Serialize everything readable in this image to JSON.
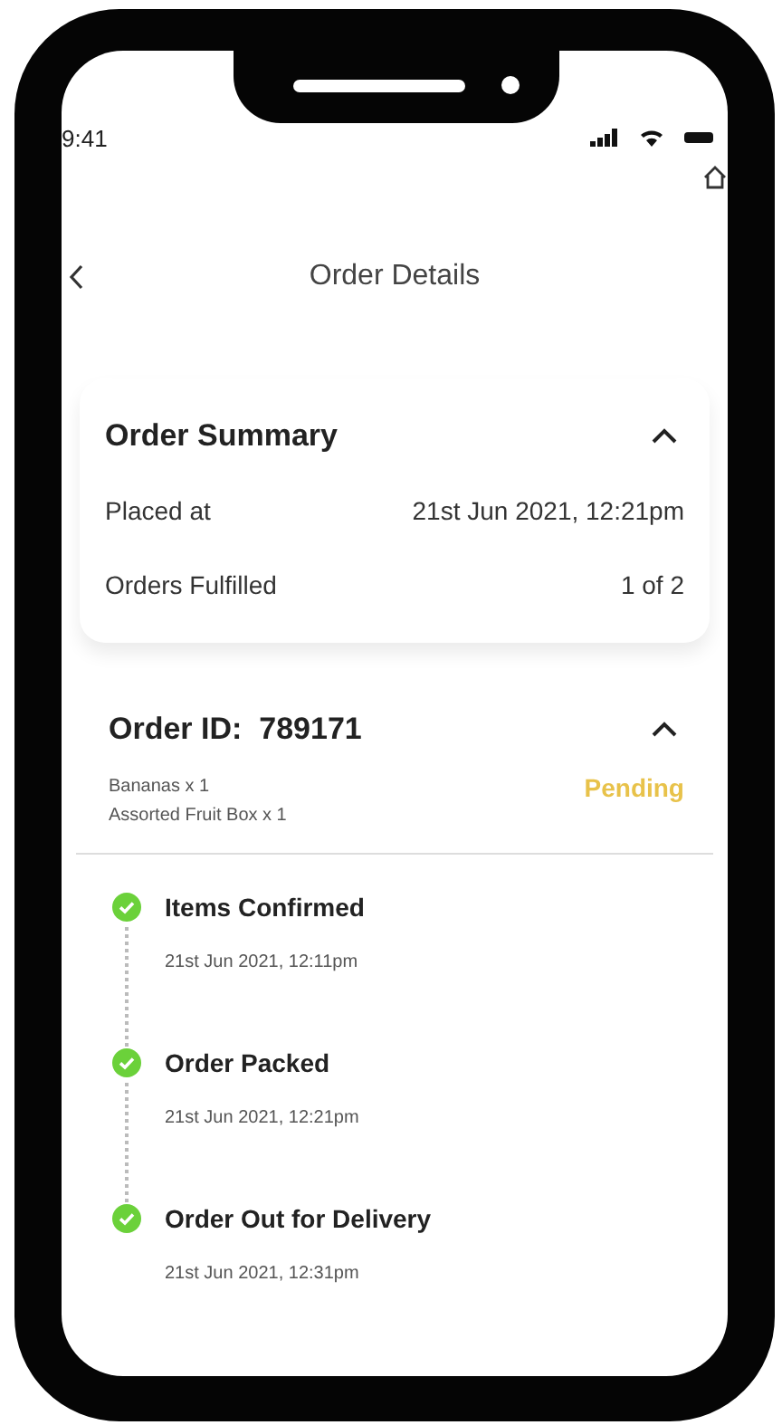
{
  "status_bar": {
    "time": "9:41"
  },
  "header": {
    "title": "Order Details"
  },
  "summary": {
    "title": "Order Summary",
    "expanded": true,
    "rows": [
      {
        "label": "Placed at",
        "value": "21st Jun 2021, 12:21pm"
      },
      {
        "label": "Orders Fulfilled",
        "value": "1 of 2"
      }
    ]
  },
  "order": {
    "title": "Order ID:  789171",
    "expanded": true,
    "status": "Pending",
    "items": [
      "Bananas x 1",
      "Assorted Fruit Box x 1"
    ]
  },
  "timeline": [
    {
      "label": "Items Confirmed",
      "time": "21st Jun 2021, 12:11pm",
      "done": true
    },
    {
      "label": "Order Packed",
      "time": "21st Jun 2021, 12:21pm",
      "done": true
    },
    {
      "label": "Order Out for Delivery",
      "time": "21st Jun 2021, 12:31pm",
      "done": true
    }
  ]
}
